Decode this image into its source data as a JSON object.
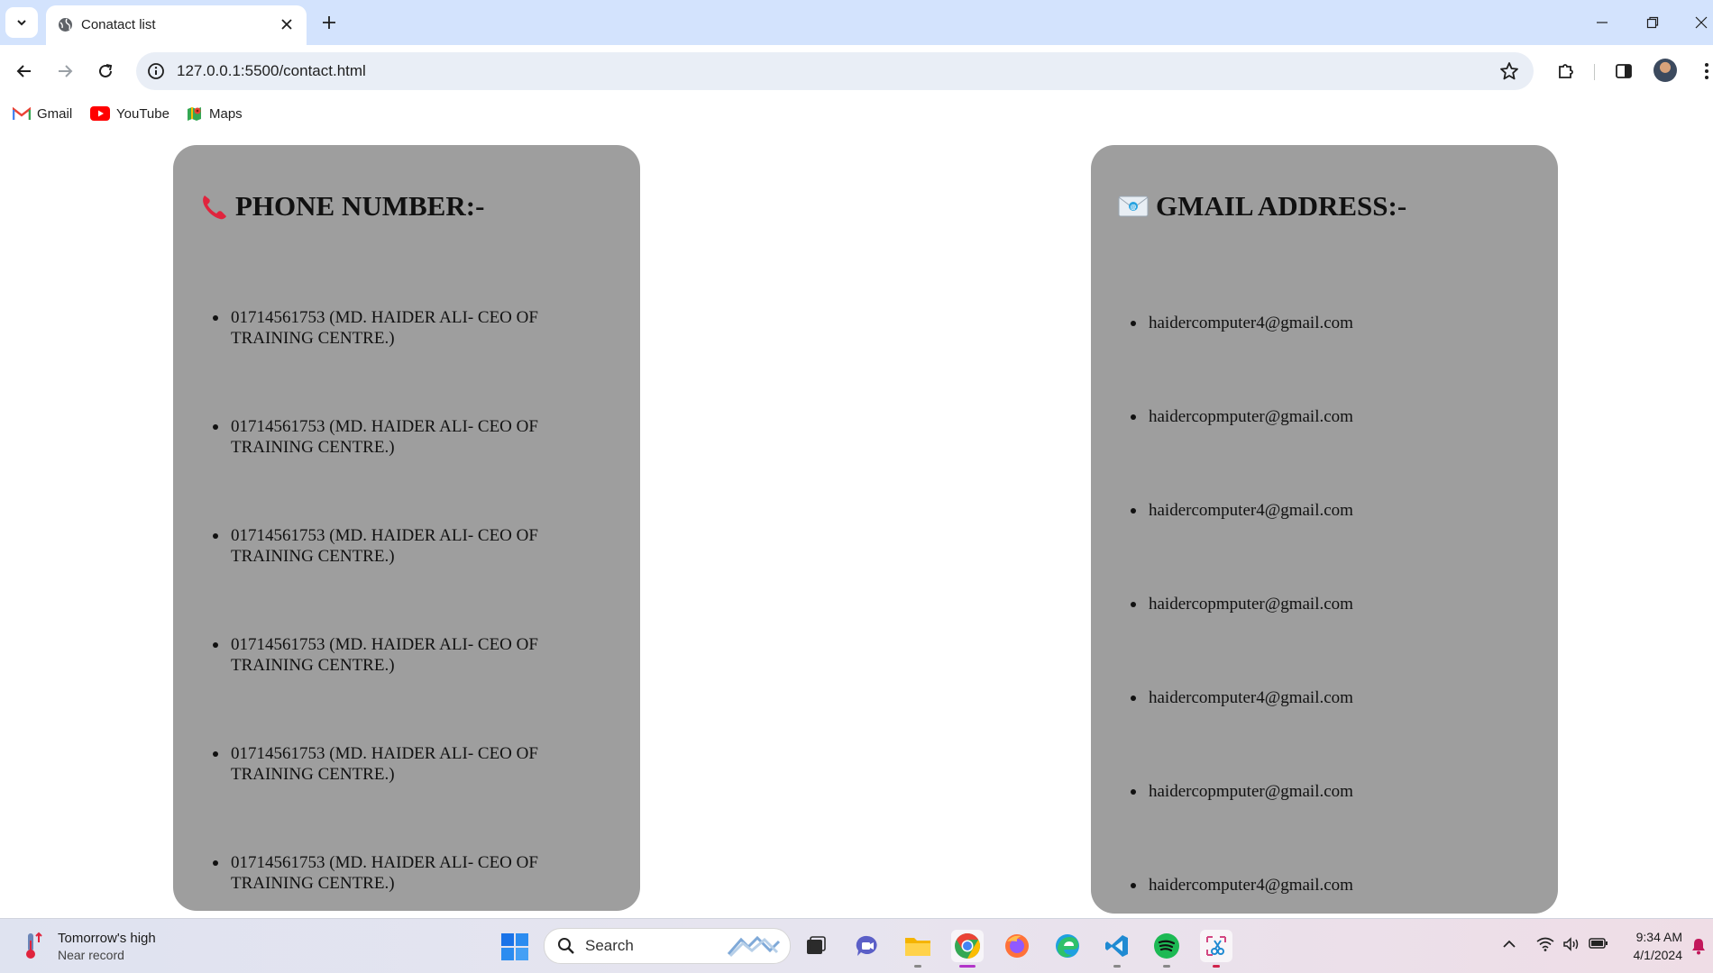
{
  "browser": {
    "tab_title": "Conatact list",
    "url": "127.0.0.1:5500/contact.html",
    "bookmarks": [
      {
        "label": "Gmail",
        "icon": "gmail-icon"
      },
      {
        "label": "YouTube",
        "icon": "youtube-icon"
      },
      {
        "label": "Maps",
        "icon": "maps-icon"
      }
    ]
  },
  "phone_panel": {
    "heading": "PHONE NUMBER:-",
    "heading_icon": "telephone-receiver-icon",
    "items": [
      "01714561753 (MD. HAIDER ALI- CEO OF TRAINING CENTRE.)",
      "01714561753 (MD. HAIDER ALI- CEO OF TRAINING CENTRE.)",
      "01714561753 (MD. HAIDER ALI- CEO OF TRAINING CENTRE.)",
      "01714561753 (MD. HAIDER ALI- CEO OF TRAINING CENTRE.)",
      "01714561753 (MD. HAIDER ALI- CEO OF TRAINING CENTRE.)",
      "01714561753 (MD. HAIDER ALI- CEO OF TRAINING CENTRE.)"
    ]
  },
  "mail_panel": {
    "heading": "GMAIL ADDRESS:-",
    "heading_icon": "envelope-icon",
    "items": [
      "haidercomputer4@gmail.com",
      "haidercopmputer@gmail.com",
      "haidercomputer4@gmail.com",
      "haidercopmputer@gmail.com",
      "haidercomputer4@gmail.com",
      "haidercopmputer@gmail.com",
      "haidercomputer4@gmail.com"
    ]
  },
  "taskbar": {
    "weather_title": "Tomorrow's high",
    "weather_subtitle": "Near record",
    "search_placeholder": "Search",
    "time": "9:34 AM",
    "date": "4/1/2024"
  },
  "colors": {
    "panel_background": "#9e9e9e",
    "tab_strip": "#d3e3fd",
    "omnibox": "#e9eef6"
  }
}
